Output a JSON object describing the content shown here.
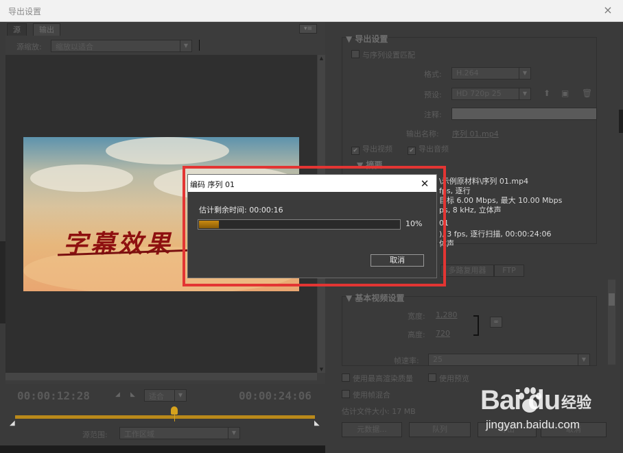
{
  "window": {
    "title": "导出设置",
    "close_glyph": "×"
  },
  "left_pane": {
    "tabs": [
      "源",
      "输出"
    ],
    "panel_menu_glyph": "▾≡",
    "source_scale": {
      "label": "源缩放:",
      "value": "缩放以适合"
    },
    "video_caption": "字幕效果",
    "timeline": {
      "current_timecode": "00:00:12:28",
      "total_timecode": "00:00:24:06",
      "fit_select": "适合",
      "playhead_fraction": 0.53,
      "source_range": {
        "label": "源范围:",
        "value": "工作区域"
      }
    }
  },
  "export_settings": {
    "section_title": "导出设置",
    "match_sequence_label": "与序列设置匹配",
    "format": {
      "label": "格式:",
      "value": "H.264"
    },
    "preset": {
      "label": "预设:",
      "value": "HD 720p 25"
    },
    "comments_label": "注释:",
    "output_name": {
      "label": "输出名称:",
      "value": "序列 01.mp4"
    },
    "export_video": {
      "label": "导出视频",
      "checked": true
    },
    "export_audio": {
      "label": "导出音频",
      "checked": true
    },
    "summary_title": "摘要",
    "summary_lines": [
      "\\示例原材料\\序列 01.mp4",
      "fps, 逐行",
      "目标 6.00 Mbps, 最大  10.00 Mbps",
      "ps, 8 kHz, 立体声",
      "01",
      "), 3 fps, 逐行扫描, 00:00:24:06",
      "体声"
    ]
  },
  "tabs_row": [
    "多路复用器",
    "FTP"
  ],
  "basic_video": {
    "section_title": "基本视频设置",
    "width": {
      "label": "宽度:",
      "value": "1,280"
    },
    "height": {
      "label": "高度:",
      "value": "720"
    },
    "frame_rate": {
      "label": "帧速率:",
      "value": "25"
    }
  },
  "options": {
    "max_render_quality": "使用最高渲染质量",
    "use_previews": "使用预览",
    "frame_blending": "使用帧混合",
    "file_size": "估计文件大小: 17 MB"
  },
  "buttons": {
    "metadata": "元数据...",
    "queue": "队列",
    "export": "导出",
    "cancel": "取消"
  },
  "encode_dialog": {
    "title": "编码 序列 01",
    "close_glyph": "✕",
    "remaining_label": "估计剩余时间: 00:00:16",
    "progress_fraction": 0.1,
    "progress_text": "10%",
    "cancel": "取消"
  },
  "watermark": {
    "logo": "Bai du",
    "brand_cn": "经验",
    "site": "jingyan.baidu.com"
  },
  "colors": {
    "highlight": "#e33533",
    "progress": "#c98a12",
    "track": "#b9891a"
  }
}
